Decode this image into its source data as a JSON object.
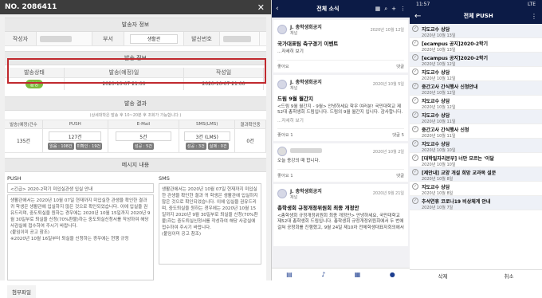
{
  "panel1": {
    "title": "NO. 2086411",
    "close": "✕",
    "sender_section": "발송자 정보",
    "author_label": "작성자",
    "dept_label": "부서",
    "dept_value": "생활관",
    "sendnum_label": "발신번호",
    "send_section": "발송 정보",
    "status_label": "발송상태",
    "scheduled_label": "발송(예정)일",
    "created_label": "작성일",
    "status_value": "발송",
    "scheduled_value": "2020-10-07 21:00",
    "created_value": "2020-10-07 21:00",
    "result_section": "발송 결과",
    "result_note": "(상세대학은 발송 후 10~20분 후 조회가 가능합니다.)",
    "result_headers": [
      "발송(예정)건수",
      "PUSH",
      "E-Mail",
      "SMS(LMS)",
      "결과확인중"
    ],
    "count_total": "135건",
    "push_count": "127건",
    "email_count": "5건",
    "sms_count": "3건 (LMS)",
    "pending_count": "0건",
    "chips_push": [
      "발송(수신) : 0건",
      "읽음 : 108건",
      "미확인 : 19건"
    ],
    "chip_email": "성공 : 5건",
    "chips_sms": [
      "성공 : 3건",
      "실패 : 0건"
    ],
    "message_section": "메시지 내용",
    "push_label": "PUSH",
    "sms_label": "SMS",
    "push_subject": "<긴급> 2020-2학기 미입실관생 입실 안내",
    "push_body": "생활관에서는 2020년 10월 07일 현재까지 미입실한 관생을 확인한 결과 귀 학생은 생활관에 입실하지 않은 것으로 확인되었습니다. 이에 입실을 권유드리며, 중도퇴실을 원하는 경우에는 2020년 10월 15일까지 2020년 9월 30일부로 퇴실을 신청(70%환불)하는 중도퇴실신청서를 작성하여 해당 사감실에 접수하여 주시기 바랍니다.\n(붙임이미 공고 참조)\n※2020년 10월 16일부터 퇴실을 신청하는 경우에는 현행 규정",
    "sms_body": "생활관에서는 2020년 10월 07일 현재까지 미입실한 관생을 확인한 결과 귀 학생은 생활관에 입실하지 않은 것으로 확인되었습니다. 이에 입실을 권유드리며, 중도퇴실을 원하는 경우에는 2020년 10월 15일까지 2020년 9월 30일부로 퇴실을 신청(70%환불)하는 중도퇴실신청서를 작성하여 해당 사감실에 접수하여 주시기 바랍니다.\n(붙임이미 공고 참조)",
    "attach_label": "첨부파일"
  },
  "panel2": {
    "top_title": "전체 소식",
    "cards": [
      {
        "author": "J. 총학생회공지",
        "sub": "채널",
        "date": "2020년 10월 12일",
        "title": "국가대표팀 축구경기 이벤트",
        "body": "...자세히 보기",
        "likes": "좋아요",
        "comments": "댓글"
      },
      {
        "author": "J. 총학생회공지",
        "sub": "채널",
        "date": "2020년 10월 5일",
        "title": "드림 9월 월간지",
        "body": "<드림 9월 월간지 - 9월> 안녕하세요 학우 여러분! 국민대학교 제52대 총학생회 드림입니다. 드림의 9월 월간지 입니다. 감사합니다.",
        "more": "...자세히 보기",
        "likes": "좋아요 1",
        "comments": "댓글 5"
      },
      {
        "author": "",
        "sub": "",
        "date": "2020년 10월 2일",
        "title": "",
        "body": "오늘 종강의 때 합니다.",
        "likes": "좋아요 1",
        "comments": "댓글"
      },
      {
        "author": "J. 총학생회공지",
        "sub": "채널",
        "date": "2020년 9월 21일",
        "title": "총학생회 규정개정위원회 최종 개정안",
        "body": "<총학생회 규정개정위원회 최종 개정안> 안녕하세요, 국민대학교 제52대 총학생회 드림입니다. 총학생회 규정개정위원회에서 두 번에 걸쳐 공청회를 진행했고, 9월 24일 제10차 전체학생대표자회의에서",
        "likes": "",
        "comments": ""
      }
    ],
    "nav": [
      "home",
      "bell",
      "calendar",
      "person"
    ]
  },
  "panel3": {
    "time": "11:57",
    "status_right": "LTE",
    "title": "전체 PUSH",
    "items": [
      {
        "title": "지도교수 상담",
        "date": "2020년 10월 13일"
      },
      {
        "title": "[ecampus 공지]2020-2학기",
        "date": "2020년 10월 13일"
      },
      {
        "title": "[ecampus 공지]2020-2학기",
        "date": "2020년 10월 12일"
      },
      {
        "title": "지도교수 상담",
        "date": "2020년 10월 12일"
      },
      {
        "title": "중간고사 간식행사 신청안내",
        "date": "2020년 10월 12일"
      },
      {
        "title": "지도교수 상담",
        "date": "2020년 10월 12일"
      },
      {
        "title": "지도교수 상담",
        "date": "2020년 10월 11일"
      },
      {
        "title": "중간고사 간식행사 신청",
        "date": "2020년 10월 11일"
      },
      {
        "title": "지도교수 상담",
        "date": "2020년 10월 10일"
      },
      {
        "title": "[대학일자리본부] 너만 모르는 '이달",
        "date": "2020년 10월 10일"
      },
      {
        "title": "[제안내] 교양 개설 희망 교과목 설문",
        "date": "2020년 10월 8일"
      },
      {
        "title": "지도교수 상담",
        "date": "2020년 10월 8일"
      },
      {
        "title": "추석연휴 코로나19 비상체계 안내",
        "date": "2020년 10월 7일"
      }
    ],
    "delete": "삭제",
    "cancel": "취소"
  }
}
